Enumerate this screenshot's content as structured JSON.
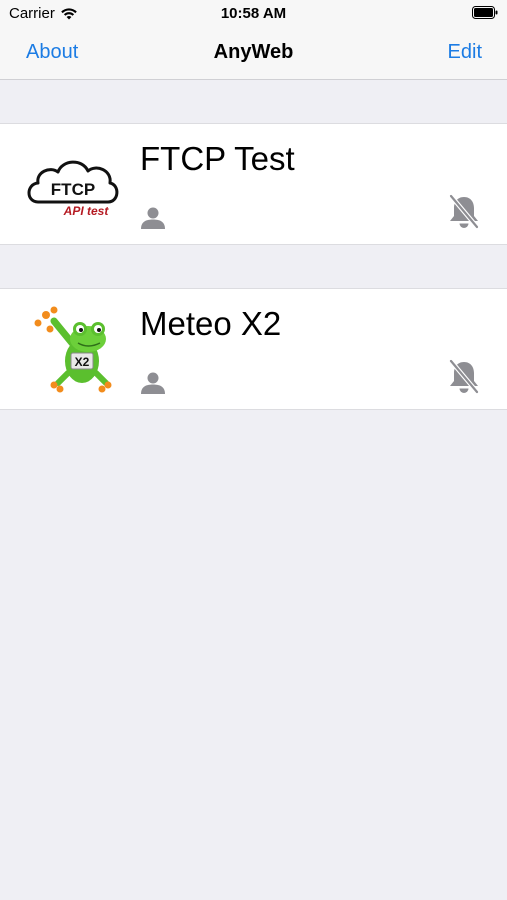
{
  "status_bar": {
    "carrier": "Carrier",
    "time": "10:58 AM"
  },
  "nav": {
    "left": "About",
    "title": "AnyWeb",
    "right": "Edit"
  },
  "items": [
    {
      "title": "FTCP Test",
      "logo_text": "FTCP",
      "logo_subtext": "API test",
      "user_icon": "person-icon",
      "notification_icon": "bell-slash-icon"
    },
    {
      "title": "Meteo X2",
      "logo_text": "X2",
      "user_icon": "person-icon",
      "notification_icon": "bell-slash-icon"
    }
  ],
  "colors": {
    "accent": "#1c7ce4",
    "background": "#efeff4",
    "icon_gray": "#8e8e93",
    "logo_red": "#b51a22",
    "frog_green": "#5bbf2e",
    "frog_orange": "#f28c1c"
  }
}
